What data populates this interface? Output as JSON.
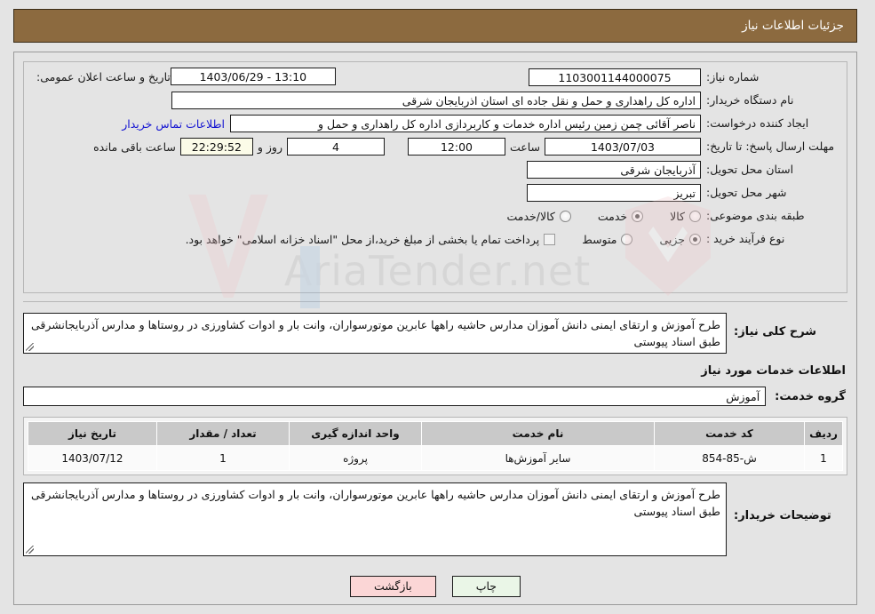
{
  "header": {
    "title": "جزئیات اطلاعات نیاز"
  },
  "watermark": {
    "text": "AriaTender.net"
  },
  "info": {
    "announce_label": "تاریخ و ساعت اعلان عمومی:",
    "announce_value": "13:10 - 1403/06/29",
    "need_no_label": "شماره نیاز:",
    "need_no_value": "1103001144000075",
    "buyer_label": "نام دستگاه خریدار:",
    "buyer_value": "اداره کل راهداری و حمل و نقل جاده ای استان اذربایجان شرقی",
    "creator_label": "ایجاد کننده درخواست:",
    "creator_value": "ناصر آقائی چمن زمین رئیس اداره خدمات و کاربردازی اداره کل راهداری و حمل و",
    "creator_link": "اطلاعات تماس خریدار",
    "deadline_label": "مهلت ارسال پاسخ: تا تاریخ:",
    "deadline_date": "1403/07/03",
    "deadline_hour_label": "ساعت",
    "deadline_hour": "12:00",
    "days_value": "4",
    "days_label": "روز و",
    "counter_value": "22:29:52",
    "counter_label": "ساعت باقی مانده",
    "province_label": "استان محل تحویل:",
    "province_value": "آذربایجان شرقی",
    "city_label": "شهر محل تحویل:",
    "city_value": "تبریز",
    "category_label": "طبقه بندی موضوعی:",
    "category_options": [
      {
        "label": "کالا",
        "selected": false
      },
      {
        "label": "خدمت",
        "selected": true
      },
      {
        "label": "کالا/خدمت",
        "selected": false
      }
    ],
    "process_label": "نوع فرآیند خرید :",
    "process_options": [
      {
        "label": "جزیی",
        "selected": true
      },
      {
        "label": "متوسط",
        "selected": false
      }
    ],
    "treasury_note": "پرداخت تمام یا بخشی از مبلغ خرید،از محل \"اسناد خزانه اسلامی\" خواهد بود.",
    "treasury_checked": false
  },
  "summary": {
    "label": "شرح کلی نیاز:",
    "value": "طرح آموزش و ارتقای ایمنی دانش آموزان مدارس حاشیه راهها عابرین موتورسواران، وانت بار و ادوات کشاورزی در روستاها و مدارس آذربایجانشرقی  طبق اسناد پیوستی"
  },
  "services": {
    "section_title": "اطلاعات خدمات مورد نیاز",
    "group_label": "گروه خدمت:",
    "group_value": "آموزش",
    "table": {
      "headers": [
        "ردیف",
        "کد خدمت",
        "نام خدمت",
        "واحد اندازه گیری",
        "تعداد / مقدار",
        "تاریخ نیاز"
      ],
      "rows": [
        {
          "radif": "1",
          "code": "ش-85-854",
          "name": "سایر آموزش‌ها",
          "unit": "پروژه",
          "qty": "1",
          "date": "1403/07/12"
        }
      ]
    }
  },
  "buyer_notes": {
    "label": "توضیحات خریدار:",
    "value": "طرح آموزش و ارتقای ایمنی دانش آموزان مدارس حاشیه راهها عابرین موتورسواران، وانت بار و ادوات کشاورزی در روستاها و مدارس آذربایجانشرقی  طبق اسناد پیوستی"
  },
  "buttons": {
    "print": "چاپ",
    "back": "بازگشت"
  }
}
